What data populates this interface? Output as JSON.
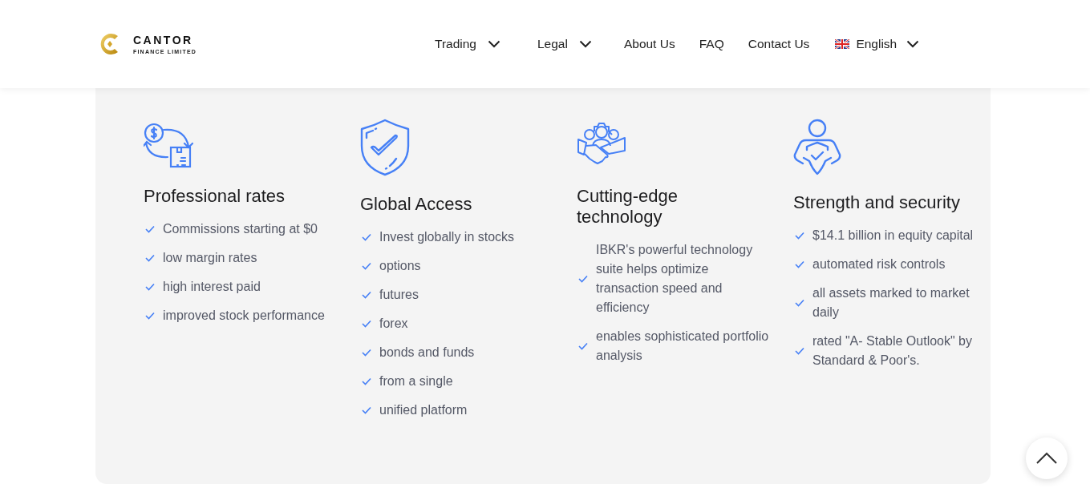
{
  "header": {
    "logo": {
      "name": "CANTOR",
      "tagline": "FINANCE LIMITED"
    },
    "nav": [
      {
        "label": "Trading",
        "kind": "dropdown"
      },
      {
        "label": "Legal",
        "kind": "dropdown"
      },
      {
        "label": "About Us",
        "kind": "link"
      },
      {
        "label": "FAQ",
        "kind": "link"
      },
      {
        "label": "Contact Us",
        "kind": "link"
      },
      {
        "label": "English",
        "kind": "language"
      }
    ]
  },
  "features": [
    {
      "title": "Professional rates",
      "items": [
        "Commissions starting at $0",
        "low margin rates",
        "high interest paid",
        "improved stock performance"
      ]
    },
    {
      "title": "Global Access",
      "items": [
        "Invest globally in stocks",
        "options",
        "futures",
        "forex",
        "bonds and funds",
        "from a single",
        "unified platform"
      ]
    },
    {
      "title": "Cutting-edge technology",
      "items": [
        "IBKR's powerful technology suite helps optimize transaction speed and efficiency",
        "enables sophisticated portfolio analysis"
      ]
    },
    {
      "title": "Strength and security",
      "items": [
        "$14.1 billion in equity capital",
        "automated risk controls",
        "all assets marked to market daily",
        "rated \"A- Stable Outlook\" by Standard & Poor's."
      ]
    }
  ]
}
